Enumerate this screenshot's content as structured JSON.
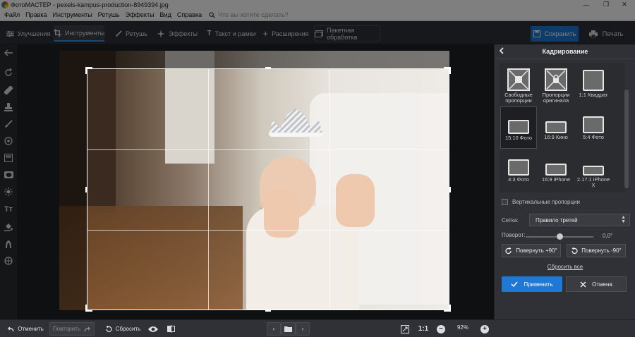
{
  "window": {
    "title": "ФотоМАСТЕР - pexels-kampus-production-8949394.jpg"
  },
  "menu": {
    "items": [
      "Файл",
      "Правка",
      "Инструменты",
      "Ретушь",
      "Эффекты",
      "Вид",
      "Справка"
    ],
    "search_placeholder": "Что вы хотите сделать?"
  },
  "toolbar": {
    "tabs": [
      "Улучшения",
      "Инструменты",
      "Ретушь",
      "Эффекты",
      "Текст и рамки",
      "Расширения",
      "Пакетная обработка"
    ],
    "save_label": "Сохранить",
    "print_label": "Печать"
  },
  "panel": {
    "title": "Кадрирование",
    "presets": [
      {
        "label": "Свободные пропорции"
      },
      {
        "label": "Пропорции оригинала"
      },
      {
        "label": "1:1 Квадрат"
      },
      {
        "label": "15:10 Фото"
      },
      {
        "label": "16:9 Кино"
      },
      {
        "label": "5:4 Фото"
      },
      {
        "label": "4:3 Фото"
      },
      {
        "label": "16:9 iPhone"
      },
      {
        "label": "2.17:1 iPhone X"
      }
    ],
    "vertical_label": "Вертикальные пропорции",
    "grid_label": "Сетка:",
    "grid_value": "Правило третей",
    "rotation_label": "Поворот:",
    "rotation_value": "0,0°",
    "rotation_level": 0.5,
    "rotate_plus": "Повернуть +90°",
    "rotate_minus": "Повернуть -90°",
    "reset_all": "Сбросить все",
    "apply": "Применить",
    "cancel": "Отмена"
  },
  "bottom": {
    "undo": "Отменить",
    "redo": "Повторить",
    "reset": "Сбросить",
    "ratio_label": "1:1",
    "zoom": "92%"
  },
  "colors": {
    "accent": "#1f77d6",
    "panel": "#2f3136",
    "canvas": "#1f2125"
  }
}
